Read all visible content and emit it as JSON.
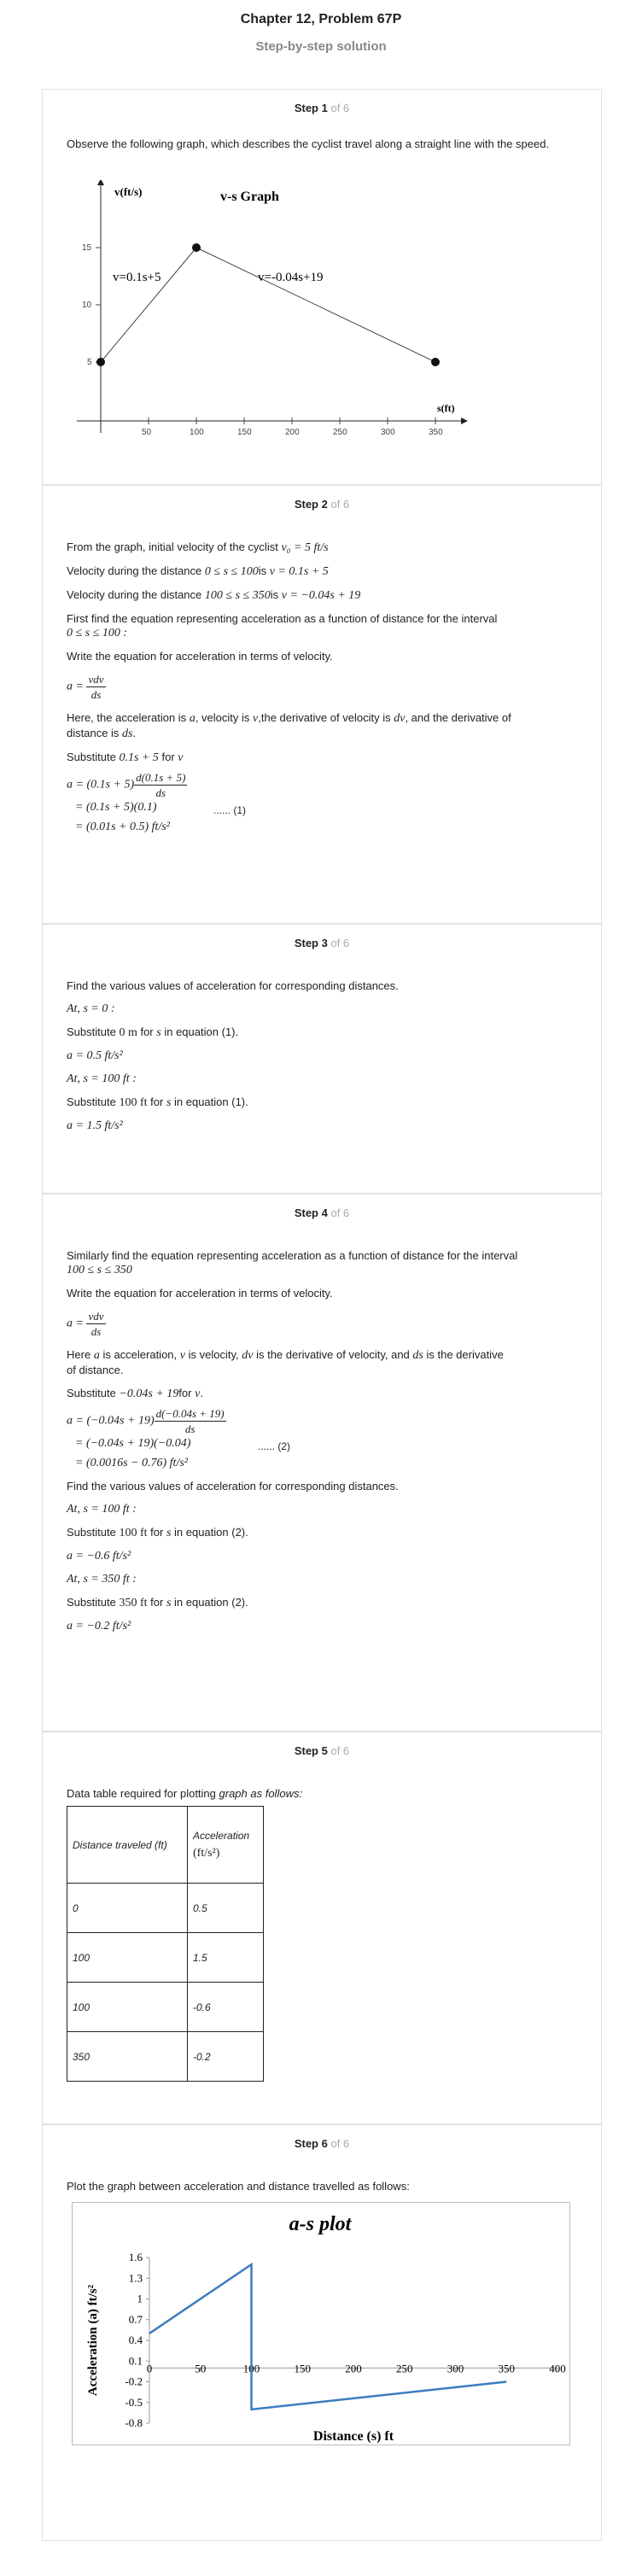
{
  "header": {
    "title": "Chapter 12, Problem 67P",
    "subtitle": "Step-by-step solution"
  },
  "steps": [
    {
      "label": "Step 1",
      "of": "of 6"
    },
    {
      "label": "Step 2",
      "of": "of 6"
    },
    {
      "label": "Step 3",
      "of": "of 6"
    },
    {
      "label": "Step 4",
      "of": "of 6"
    },
    {
      "label": "Step 5",
      "of": "of 6"
    },
    {
      "label": "Step 6",
      "of": "of 6"
    }
  ],
  "step1": {
    "text": "Observe the following graph, which describes the cyclist travel along a straight line with the speed.",
    "graph": {
      "title": "v-s Graph",
      "ylabel": "v(ft/s)",
      "xlabel": "s(ft)",
      "line1_label": "v=0.1s+5",
      "line2_label": "v=-0.04s+19",
      "yticks": [
        "5",
        "10",
        "15"
      ],
      "xticks": [
        "50",
        "100",
        "150",
        "200",
        "250",
        "300",
        "350"
      ]
    }
  },
  "step2": {
    "l1a": "From the graph, initial velocity of the cyclist",
    "l1b": "v₀ = 5 ft/s",
    "l2a": "Velocity during the distance",
    "l2b": "0 ≤ s ≤ 100",
    "l2c": "is",
    "l2d": "v = 0.1s + 5",
    "l3a": "Velocity during the distance",
    "l3b": "100 ≤ s ≤ 350",
    "l3c": "is",
    "l3d": "v = −0.04s + 19",
    "l4": "First find the equation representing acceleration as a function of distance for the interval",
    "l4b": "0 ≤ s ≤ 100 :",
    "l5": "Write the equation for acceleration in terms of velocity.",
    "eq_a": "a =",
    "eq_num": "vdv",
    "eq_den": "ds",
    "l6a": "Here, the acceleration is",
    "l6b": "a",
    "l6c": ", velocity is",
    "l6d": "v",
    "l6e": ",the derivative of velocity is",
    "l6f": "dv",
    "l6g": ", and the derivative of",
    "l6h": "distance is",
    "l6i": "ds",
    "l6j": ".",
    "l7a": "Substitute",
    "l7b": "0.1s + 5",
    "l7c": "for",
    "l7d": "v",
    "d1a": "a = (0.1s + 5)",
    "d1num": "d(0.1s + 5)",
    "d1den": "ds",
    "d2": "= (0.1s + 5)(0.1)",
    "d3": "= (0.01s + 0.5) ft/s²",
    "tag": "...... (1)"
  },
  "step3": {
    "l1": "Find the various values of acceleration for corresponding distances.",
    "l2": "At, s = 0 :",
    "l3a": "Substitute",
    "l3b": "0 m",
    "l3c": "for",
    "l3d": "s",
    "l3e": "in equation (1).",
    "l4": "a = 0.5 ft/s²",
    "l5": "At, s = 100 ft :",
    "l6a": "Substitute",
    "l6b": "100 ft",
    "l6c": "for",
    "l6d": "s",
    "l6e": "in equation (1).",
    "l7": "a = 1.5 ft/s²"
  },
  "step4": {
    "l1": "Similarly find the equation representing acceleration as a function of distance for the interval",
    "l1b": "100 ≤ s ≤ 350",
    "l2": "Write the equation for acceleration in terms of velocity.",
    "eq_a": "a =",
    "eq_num": "vdv",
    "eq_den": "ds",
    "l3a": "Here",
    "l3b": "a",
    "l3c": "is acceleration,",
    "l3d": "v",
    "l3e": "is velocity,",
    "l3f": "dv",
    "l3g": "is the derivative of velocity, and",
    "l3h": "ds",
    "l3i": "is the derivative",
    "l3j": "of distance.",
    "l4a": "Substitute",
    "l4b": "−0.04s + 19",
    "l4c": "for",
    "l4d": "v",
    "l4e": ".",
    "d1a": "a = (−0.04s + 19)",
    "d1num": "d(−0.04s + 19)",
    "d1den": "ds",
    "d2": "= (−0.04s + 19)(−0.04)",
    "d3": "= (0.0016s − 0.76) ft/s²",
    "tag": "...... (2)",
    "l5": "Find the various values of acceleration for corresponding distances.",
    "l6": "At, s = 100 ft :",
    "l7a": "Substitute",
    "l7b": "100 ft",
    "l7c": "for",
    "l7d": "s",
    "l7e": "in equation (2).",
    "l8": "a = −0.6 ft/s²",
    "l9": "At, s = 350 ft :",
    "l10a": "Substitute",
    "l10b": "350 ft",
    "l10c": "for",
    "l10d": "s",
    "l10e": "in equation (2).",
    "l11": "a = −0.2 ft/s²"
  },
  "step5": {
    "l1a": "Data table required for plotting",
    "l1b": "graph as follows:",
    "col1": "Distance traveled (ft)",
    "col2a": "Acceleration",
    "col2b": "(ft/s²)",
    "rows": [
      [
        "0",
        "0.5"
      ],
      [
        "100",
        "1.5"
      ],
      [
        "100",
        "-0.6"
      ],
      [
        "350",
        "-0.2"
      ]
    ]
  },
  "step6": {
    "l1": "Plot the graph between acceleration and distance travelled as follows:"
  },
  "chart_data": {
    "type": "line",
    "title": "a-s plot",
    "xlabel": "Distance (s) ft",
    "ylabel": "Acceleration (a) ft/s²",
    "x": [
      0,
      100,
      100,
      350
    ],
    "y": [
      0.5,
      1.5,
      -0.6,
      -0.2
    ],
    "xlim": [
      0,
      400
    ],
    "ylim": [
      -0.8,
      1.6
    ],
    "xticks": [
      "0",
      "50",
      "100",
      "150",
      "200",
      "250",
      "300",
      "350",
      "400"
    ],
    "yticks": [
      "-0.8",
      "-0.5",
      "-0.2",
      "0.1",
      "0.4",
      "0.7",
      "1",
      "1.3",
      "1.6"
    ],
    "color": "#3d7cc0",
    "grid": false
  }
}
